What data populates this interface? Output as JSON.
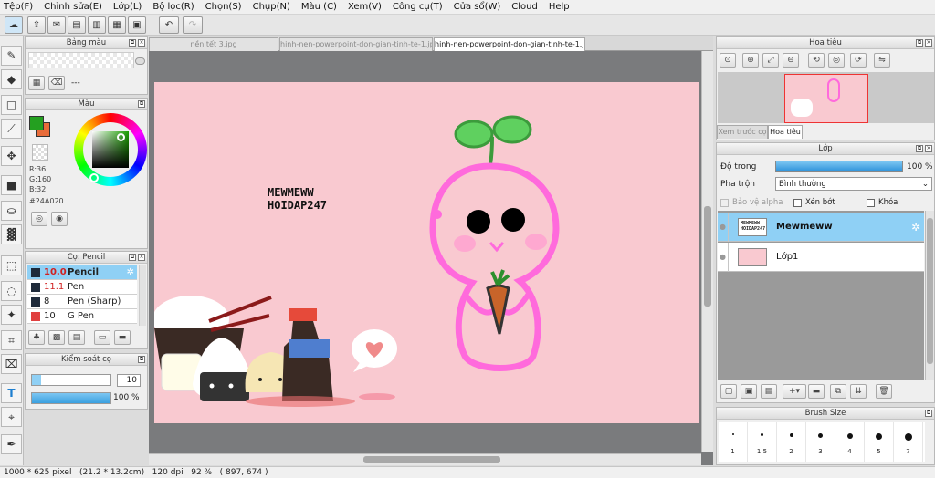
{
  "menu": [
    "Tệp(F)",
    "Chỉnh sửa(E)",
    "Lớp(L)",
    "Bộ lọc(R)",
    "Chọn(S)",
    "Chụp(N)",
    "Màu (C)",
    "Xem(V)",
    "Công cụ(T)",
    "Cửa sổ(W)",
    "Cloud",
    "Help"
  ],
  "tabs": [
    "nền tết 3.jpg",
    "hinh-nen-powerpoint-don-gian-tinh-te-1.jpg",
    "hinh-nen-powerpoint-don-gian-tinh-te-1.jpg"
  ],
  "palette_panel": {
    "title": "Bảng màu",
    "value": "---"
  },
  "color_panel": {
    "title": "Màu",
    "r": "R:36",
    "g": "G:160",
    "b": "B:32",
    "hex": "#24A020",
    "fg": "#24A020",
    "bg": "#E86C3A"
  },
  "brush_panel": {
    "title": "Cọ: Pencil",
    "items": [
      {
        "size": "10.0",
        "name": "Pencil",
        "color": "#1e2a3a"
      },
      {
        "size": "11.1",
        "name": "Pen",
        "color": "#1e2a3a"
      },
      {
        "size": "8",
        "name": "Pen (Sharp)",
        "color": "#1e2a3a"
      },
      {
        "size": "10",
        "name": "G Pen",
        "color": "#e04040"
      }
    ]
  },
  "control_panel": {
    "title": "Kiểm soát cọ",
    "size_value": "10",
    "opacity_value": "100 %",
    "size_fraction": 0.12,
    "opacity_fraction": 1.0
  },
  "navigator_panel": {
    "title": "Hoa tiêu",
    "tabs": [
      "Xem trước cọ",
      "Hoa tiêu"
    ]
  },
  "layer_panel": {
    "title": "Lớp",
    "opacity_label": "Độ trong",
    "opacity_value": "100 %",
    "blend_label": "Pha trộn",
    "blend_value": "Bình thường",
    "options": [
      "Bảo vệ alpha",
      "Xén bớt",
      "Khóa"
    ],
    "layers": [
      {
        "name": "Mewmeww",
        "thumb_text": "MEWMEWW HOIDAP247",
        "selected": true
      },
      {
        "name": "Lớp1",
        "thumb_text": "",
        "selected": false
      }
    ]
  },
  "brushsize_panel": {
    "title": "Brush Size",
    "sizes": [
      "1",
      "1.5",
      "2",
      "3",
      "4",
      "5",
      "7"
    ]
  },
  "artwork": {
    "line1": "MEWMEWW",
    "line2": "HOIDAP247"
  },
  "status": "1000 * 625 pixel   (21.2 * 13.2cm)   120 dpi   92 %   ( 897, 674 )"
}
